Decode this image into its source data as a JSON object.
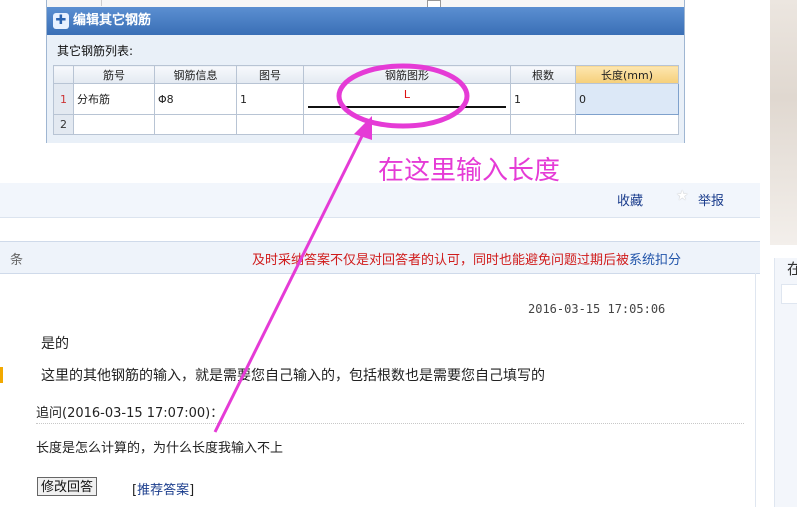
{
  "dialog": {
    "title": "编辑其它钢筋",
    "list_label": "其它钢筋列表:",
    "columns": [
      "",
      "筋号",
      "钢筋信息",
      "图号",
      "钢筋图形",
      "根数",
      "长度(mm)"
    ],
    "rows": [
      {
        "no": "1",
        "name": "分布筋",
        "info": "Φ8",
        "fig_no": "1",
        "shape_label": "L",
        "count": "1",
        "length": "0"
      },
      {
        "no": "2",
        "name": "",
        "info": "",
        "fig_no": "",
        "shape_label": "",
        "count": "",
        "length": ""
      }
    ]
  },
  "annotation": {
    "text": "在这里输入长度",
    "color": "#e53bd6"
  },
  "toolbar": {
    "favorite": "收藏",
    "report": "举报"
  },
  "answer_header": {
    "count_suffix": "条",
    "notice_red": "及时采纳答案不仅是对回答者的认可，同时也能避免问题过期后被",
    "notice_blue": "系统扣分"
  },
  "side": {
    "char": "在"
  },
  "answer": {
    "timestamp": "2016-03-15 17:05:06",
    "line1": "是的",
    "line2": "这里的其他钢筋的输入，就是需要您自己输入的，包括根数也是需要您自己填写的",
    "followup": "追问(2016-03-15 17:07:00)：",
    "question": "长度是怎么计算的，为什么长度我输入不上",
    "modify_button": "修改回答",
    "recommend_open": "[",
    "recommend_link": "推荐答案",
    "recommend_close": "]"
  },
  "colors": {
    "title_bar": "#3a6fb6",
    "notice_red": "#d01b1b",
    "link_blue": "#1a3c8c",
    "annotation": "#e53bd6"
  }
}
